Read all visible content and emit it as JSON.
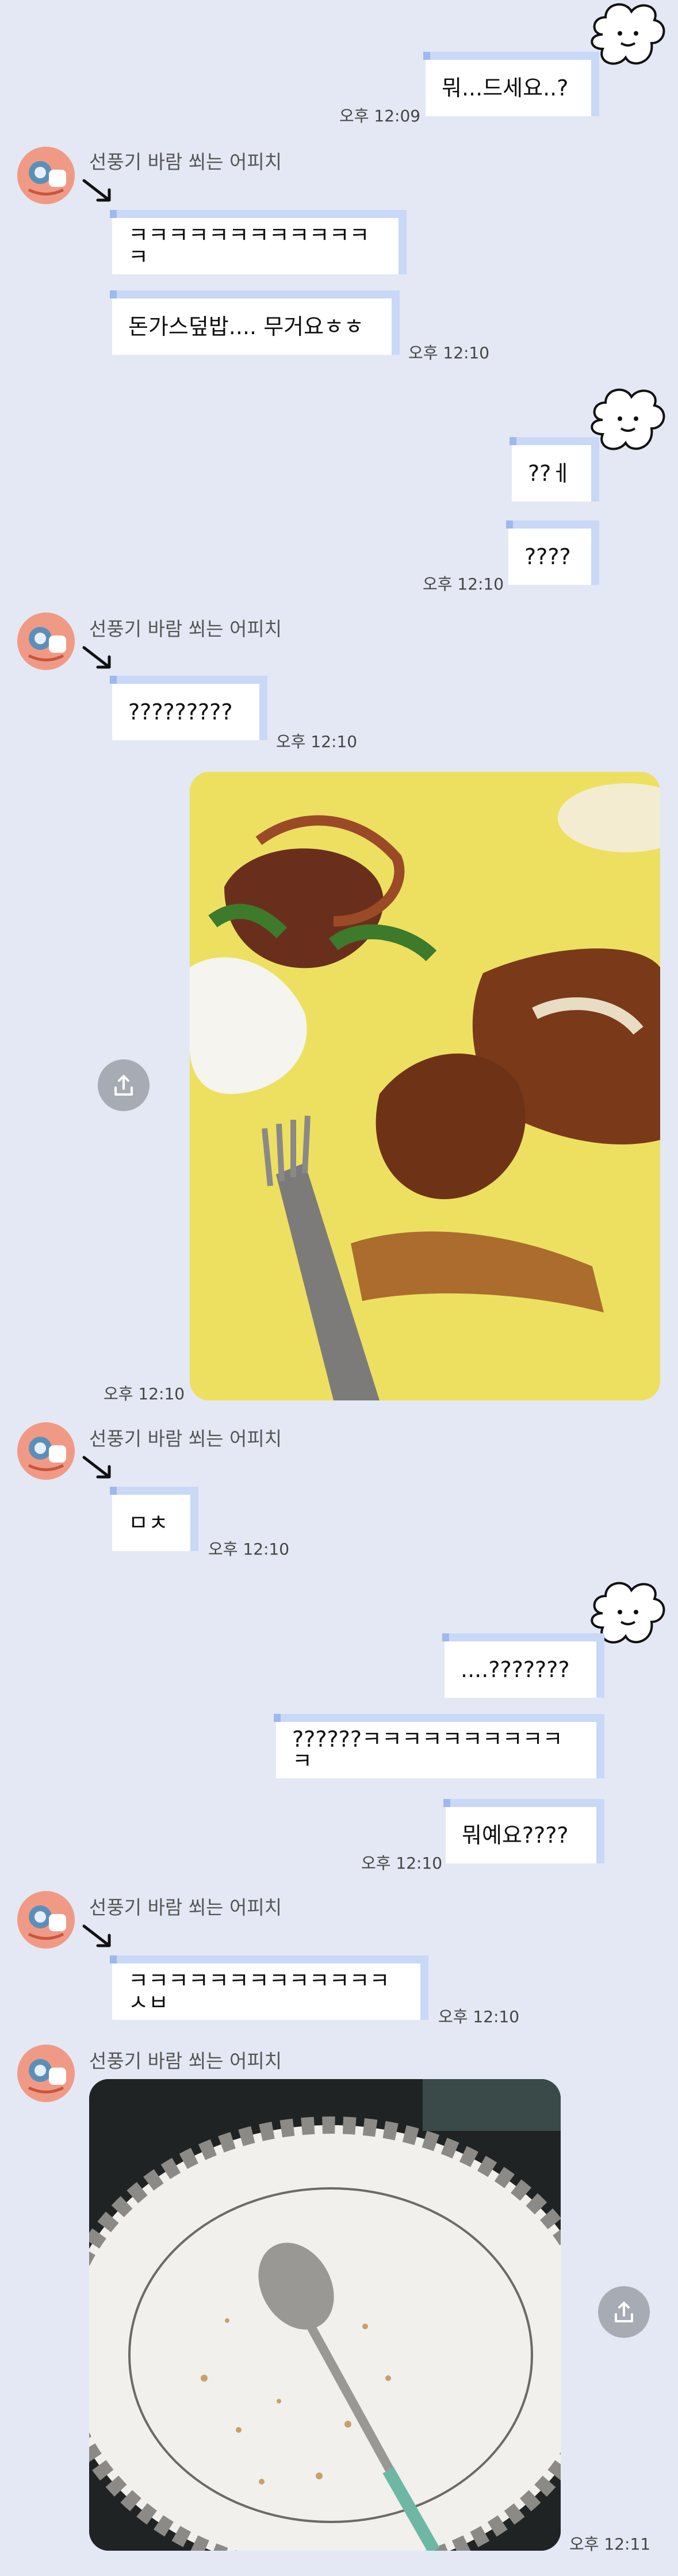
{
  "sender_name": "선풍기 바람 쐬는 어피치",
  "colors": {
    "background": "#e3e8f4",
    "bubble": "#ffffff",
    "bubble_accent": "#c9d8f7"
  },
  "messages": {
    "m1": {
      "text": "뭐...드세요..?",
      "time": "오후 12:09"
    },
    "m2": {
      "text": "ㅋㅋㅋㅋㅋㅋㅋㅋㅋㅋㅋㅋㅋ"
    },
    "m3": {
      "text": "돈가스덮밥.... 무거요ㅎㅎ",
      "time": "오후 12:10"
    },
    "m4": {
      "text": "??ㅔ"
    },
    "m5": {
      "text": "????",
      "time": "오후 12:10"
    },
    "m6": {
      "text": "?????????",
      "time": "오후 12:10"
    },
    "m7": {
      "time": "오후 12:10"
    },
    "m8": {
      "text": "ㅁㅊ",
      "time": "오후 12:10"
    },
    "m9": {
      "text": "....???????"
    },
    "m10": {
      "text": "??????ㅋㅋㅋㅋㅋㅋㅋㅋㅋㅋㅋ"
    },
    "m11": {
      "text": "뭐예요????",
      "time": "오후 12:10"
    },
    "m12": {
      "text": "ㅋㅋㅋㅋㅋㅋㅋㅋㅋㅋㅋㅋㅋㅅㅂ",
      "time": "오후 12:10"
    },
    "m13": {
      "time": "오후 12:11"
    }
  },
  "icons": {
    "share": "share-icon",
    "arrow": "arrow-icon",
    "cloud": "cloud-icon"
  }
}
